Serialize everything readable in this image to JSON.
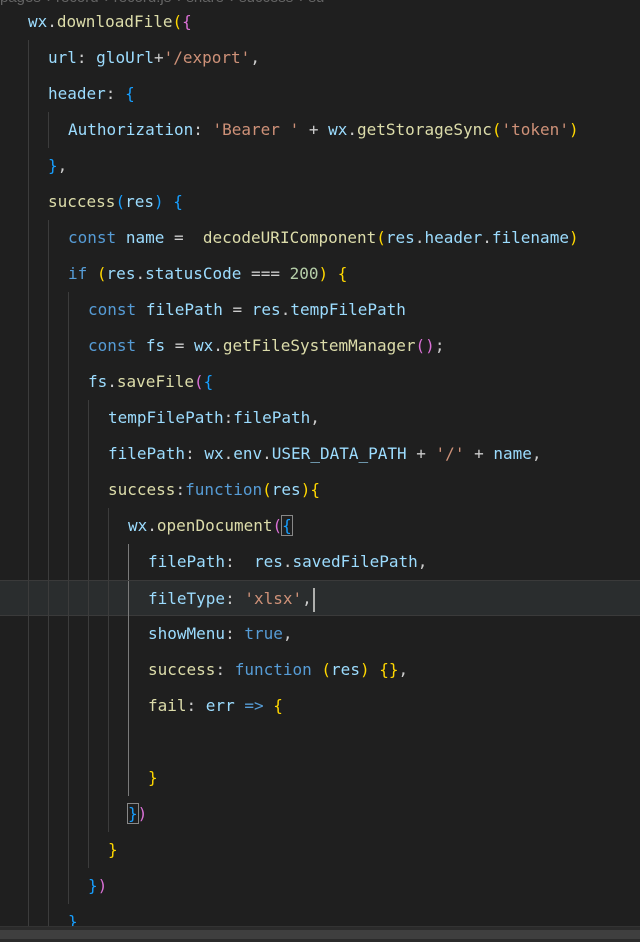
{
  "breadcrumb": [
    "pages",
    "record",
    "record.js",
    "share",
    "success",
    "su"
  ],
  "colors": {
    "background": "#1f1f1f",
    "current_line": "#2a2d2e",
    "variable": "#9cdcfe",
    "function": "#dcdcaa",
    "string": "#ce9178",
    "keyword": "#569cd6",
    "number": "#b5cea8",
    "bracket_gold": "#ffd700",
    "bracket_purple": "#da70d6",
    "bracket_blue": "#179fff"
  },
  "code_lines": [
    {
      "tokens": [
        [
          "wx",
          "v"
        ],
        [
          ".",
          "p"
        ],
        [
          "downloadFile",
          "f"
        ],
        [
          "(",
          "b1"
        ],
        [
          "{",
          "b2"
        ]
      ]
    },
    {
      "tokens": [
        [
          "url",
          "v"
        ],
        [
          ": ",
          "p"
        ],
        [
          "gloUrl",
          "v"
        ],
        [
          "+",
          "p"
        ],
        [
          "'/export'",
          "s"
        ],
        [
          ",",
          "p"
        ]
      ]
    },
    {
      "tokens": [
        [
          "header",
          "v"
        ],
        [
          ": ",
          "p"
        ],
        [
          "{",
          "b3"
        ]
      ]
    },
    {
      "tokens": [
        [
          "Authorization",
          "v"
        ],
        [
          ": ",
          "p"
        ],
        [
          "'Bearer '",
          "s"
        ],
        [
          " + ",
          "p"
        ],
        [
          "wx",
          "v"
        ],
        [
          ".",
          "p"
        ],
        [
          "getStorageSync",
          "f"
        ],
        [
          "(",
          "b1"
        ],
        [
          "'token'",
          "s"
        ],
        [
          ")",
          "b1"
        ]
      ]
    },
    {
      "tokens": [
        [
          "}",
          "b3"
        ],
        [
          ",",
          "p"
        ]
      ]
    },
    {
      "tokens": [
        [
          "success",
          "f"
        ],
        [
          "(",
          "b3"
        ],
        [
          "res",
          "v"
        ],
        [
          ")",
          "b3"
        ],
        [
          " ",
          "p"
        ],
        [
          "{",
          "b3"
        ]
      ]
    },
    {
      "tokens": [
        [
          "const",
          "k"
        ],
        [
          " ",
          "p"
        ],
        [
          "name",
          "v"
        ],
        [
          " =  ",
          "p"
        ],
        [
          "decodeURIComponent",
          "f"
        ],
        [
          "(",
          "b1"
        ],
        [
          "res",
          "v"
        ],
        [
          ".",
          "p"
        ],
        [
          "header",
          "v"
        ],
        [
          ".",
          "p"
        ],
        [
          "filename",
          "v"
        ],
        [
          ")",
          "b1"
        ]
      ]
    },
    {
      "tokens": [
        [
          "if",
          "k"
        ],
        [
          " ",
          "p"
        ],
        [
          "(",
          "b1"
        ],
        [
          "res",
          "v"
        ],
        [
          ".",
          "p"
        ],
        [
          "statusCode",
          "v"
        ],
        [
          " === ",
          "p"
        ],
        [
          "200",
          "n"
        ],
        [
          ")",
          "b1"
        ],
        [
          " ",
          "p"
        ],
        [
          "{",
          "b1"
        ]
      ]
    },
    {
      "tokens": [
        [
          "const",
          "k"
        ],
        [
          " ",
          "p"
        ],
        [
          "filePath",
          "v"
        ],
        [
          " = ",
          "p"
        ],
        [
          "res",
          "v"
        ],
        [
          ".",
          "p"
        ],
        [
          "tempFilePath",
          "v"
        ]
      ]
    },
    {
      "tokens": [
        [
          "const",
          "k"
        ],
        [
          " ",
          "p"
        ],
        [
          "fs",
          "v"
        ],
        [
          " = ",
          "p"
        ],
        [
          "wx",
          "v"
        ],
        [
          ".",
          "p"
        ],
        [
          "getFileSystemManager",
          "f"
        ],
        [
          "()",
          "b2"
        ],
        [
          ";",
          "p"
        ]
      ]
    },
    {
      "tokens": [
        [
          "fs",
          "v"
        ],
        [
          ".",
          "p"
        ],
        [
          "saveFile",
          "f"
        ],
        [
          "(",
          "b2"
        ],
        [
          "{",
          "b3"
        ]
      ]
    },
    {
      "tokens": [
        [
          "tempFilePath",
          "v"
        ],
        [
          ":",
          "p"
        ],
        [
          "filePath",
          "v"
        ],
        [
          ",",
          "p"
        ]
      ]
    },
    {
      "tokens": [
        [
          "filePath",
          "v"
        ],
        [
          ": ",
          "p"
        ],
        [
          "wx",
          "v"
        ],
        [
          ".",
          "p"
        ],
        [
          "env",
          "v"
        ],
        [
          ".",
          "p"
        ],
        [
          "USER_DATA_PATH",
          "v"
        ],
        [
          " + ",
          "p"
        ],
        [
          "'/'",
          "s"
        ],
        [
          " + ",
          "p"
        ],
        [
          "name",
          "v"
        ],
        [
          ",",
          "p"
        ]
      ]
    },
    {
      "tokens": [
        [
          "success",
          "f"
        ],
        [
          ":",
          "p"
        ],
        [
          "function",
          "k"
        ],
        [
          "(",
          "b1"
        ],
        [
          "res",
          "v"
        ],
        [
          ")",
          "b1"
        ],
        [
          "{",
          "b1"
        ]
      ]
    },
    {
      "tokens": [
        [
          "wx",
          "v"
        ],
        [
          ".",
          "p"
        ],
        [
          "openDocument",
          "f"
        ],
        [
          "(",
          "b2"
        ],
        [
          "{",
          "b3"
        ]
      ]
    },
    {
      "tokens": [
        [
          "filePath",
          "v"
        ],
        [
          ":  ",
          "p"
        ],
        [
          "res",
          "v"
        ],
        [
          ".",
          "p"
        ],
        [
          "savedFilePath",
          "v"
        ],
        [
          ",",
          "p"
        ]
      ]
    },
    {
      "tokens": [
        [
          "fileType",
          "v"
        ],
        [
          ": ",
          "p"
        ],
        [
          "'xlsx'",
          "s"
        ],
        [
          ",",
          "p"
        ]
      ]
    },
    {
      "tokens": [
        [
          "showMenu",
          "v"
        ],
        [
          ": ",
          "p"
        ],
        [
          "true",
          "k"
        ],
        [
          ",",
          "p"
        ]
      ]
    },
    {
      "tokens": [
        [
          "success",
          "f"
        ],
        [
          ": ",
          "p"
        ],
        [
          "function",
          "k"
        ],
        [
          " ",
          "p"
        ],
        [
          "(",
          "b1"
        ],
        [
          "res",
          "v"
        ],
        [
          ")",
          "b1"
        ],
        [
          " ",
          "p"
        ],
        [
          "{}",
          "b1"
        ],
        [
          ",",
          "p"
        ]
      ]
    },
    {
      "tokens": [
        [
          "fail",
          "f"
        ],
        [
          ": ",
          "p"
        ],
        [
          "err",
          "v"
        ],
        [
          " => ",
          "k"
        ],
        [
          "{",
          "b1"
        ]
      ]
    },
    {
      "tokens": []
    },
    {
      "tokens": [
        [
          "}",
          "b1"
        ]
      ]
    },
    {
      "tokens": [
        [
          "}",
          "b3"
        ],
        [
          ")",
          "b2"
        ]
      ]
    },
    {
      "tokens": [
        [
          "}",
          "b1"
        ]
      ]
    },
    {
      "tokens": [
        [
          "}",
          "b3"
        ],
        [
          ")",
          "b2"
        ]
      ]
    },
    {
      "tokens": [
        [
          "}",
          "b3"
        ]
      ]
    }
  ]
}
